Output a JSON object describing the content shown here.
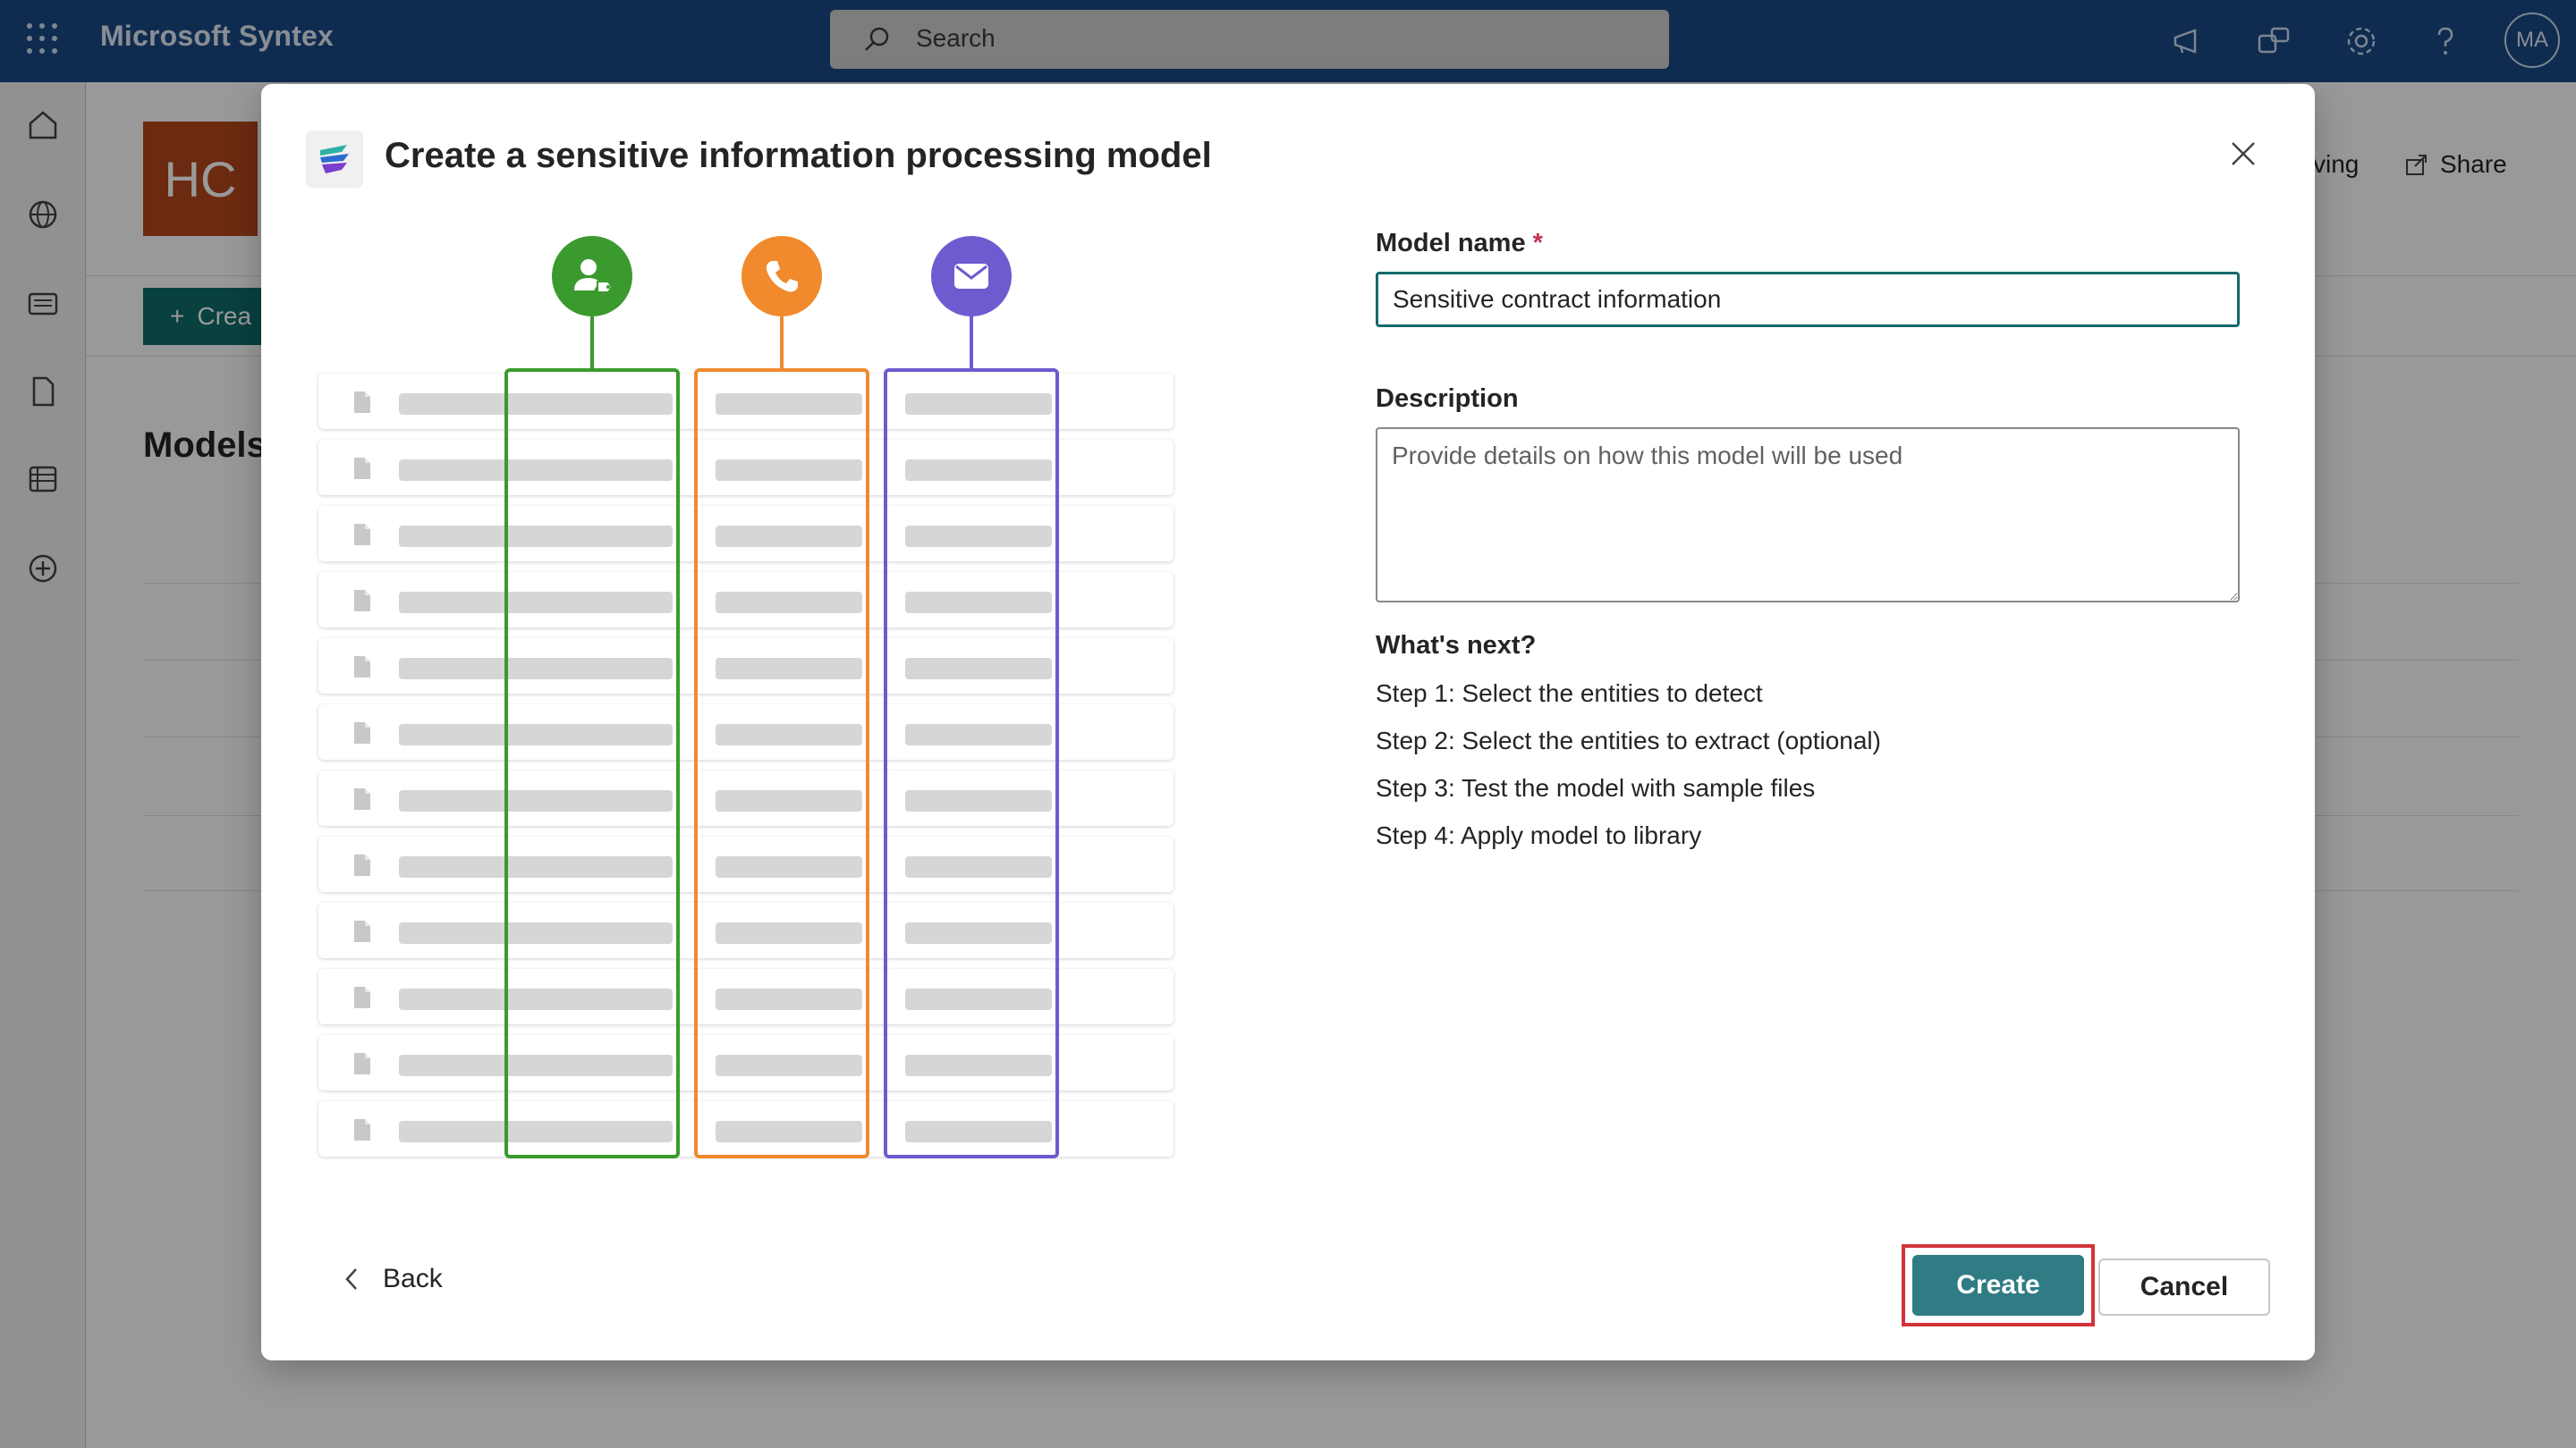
{
  "app": {
    "title": "Microsoft Syntex",
    "search_placeholder": "Search",
    "avatar_initials": "MA",
    "colors": {
      "topbar": "#1a4a85",
      "accent": "#2f7c84"
    }
  },
  "background_page": {
    "site_initials": "HC",
    "share_label": "Share",
    "partial_following_label": "ving",
    "create_label": "Crea",
    "models_heading": "Models"
  },
  "dialog": {
    "title": "Create a sensitive information processing model",
    "illustration": {
      "row_count": 12,
      "columns": [
        {
          "icon": "person-tag-icon",
          "color": "#3a9a2e"
        },
        {
          "icon": "phone-icon",
          "color": "#f08a2d"
        },
        {
          "icon": "mail-icon",
          "color": "#6d5bd0"
        }
      ]
    },
    "model_name": {
      "label": "Model name",
      "required_mark": "*",
      "value": "Sensitive contract information"
    },
    "description": {
      "label": "Description",
      "placeholder": "Provide details on how this model will be used"
    },
    "whats_next": {
      "heading": "What's next?",
      "steps": [
        "Step 1: Select the entities to detect",
        "Step 2: Select the entities to extract (optional)",
        "Step 3: Test the model with sample files",
        "Step 4: Apply model to library"
      ]
    },
    "footer": {
      "back_label": "Back",
      "create_label": "Create",
      "cancel_label": "Cancel"
    }
  }
}
